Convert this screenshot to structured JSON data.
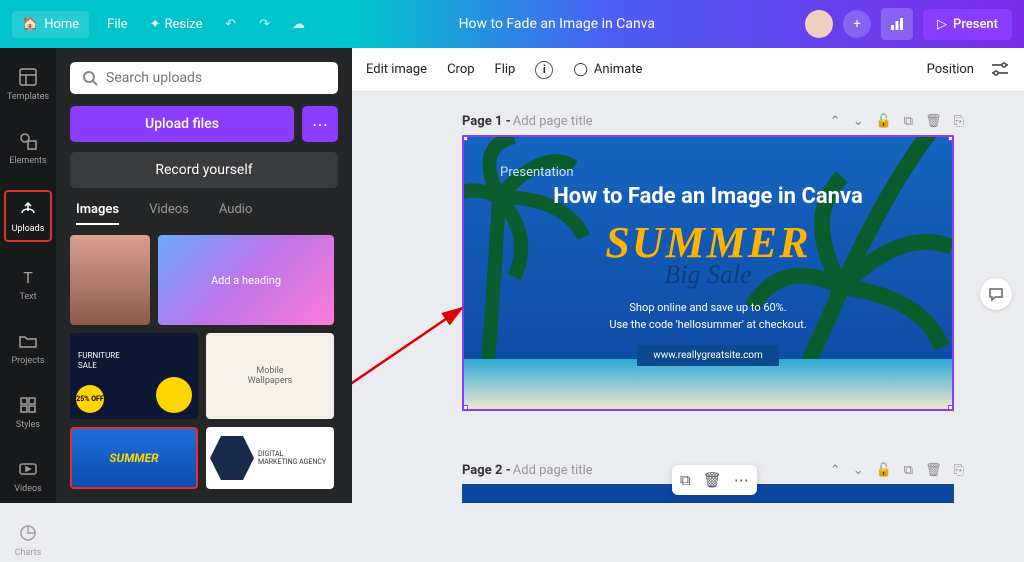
{
  "topbar": {
    "home": "Home",
    "file": "File",
    "resize": "Resize",
    "doc_title": "How to Fade an Image in Canva",
    "present": "Present"
  },
  "rail": {
    "templates": "Templates",
    "elements": "Elements",
    "uploads": "Uploads",
    "text": "Text",
    "projects": "Projects",
    "styles": "Styles",
    "videos": "Videos",
    "charts": "Charts"
  },
  "panel": {
    "search_ph": "Search uploads",
    "upload": "Upload files",
    "record": "Record yourself",
    "tabs": {
      "images": "Images",
      "videos": "Videos",
      "audio": "Audio"
    },
    "heading_thumb": "Add a heading",
    "furniture": "FURNITURE",
    "sale": "SALE",
    "off": "25% OFF",
    "mobile": "Mobile",
    "wallpapers": "Wallpapers",
    "summer_thumb": "SUMMER",
    "agency1": "DIGITAL",
    "agency2": "MARKETING AGENCY"
  },
  "context": {
    "edit": "Edit image",
    "crop": "Crop",
    "flip": "Flip",
    "animate": "Animate",
    "position": "Position"
  },
  "pages": {
    "p1_label": "Page 1 - ",
    "p1_ph": "Add page title",
    "p2_label": "Page 2 - ",
    "p2_ph": "Add page title"
  },
  "slide": {
    "pres": "Presentation",
    "title": "How to Fade an Image in Canva",
    "summer": "SUMMER",
    "bigsale": "Big Sale",
    "shop1": "Shop online and save up to 60%.",
    "shop2": "Use the code 'hellosummer' at checkout.",
    "site": "www.reallygreatsite.com"
  }
}
